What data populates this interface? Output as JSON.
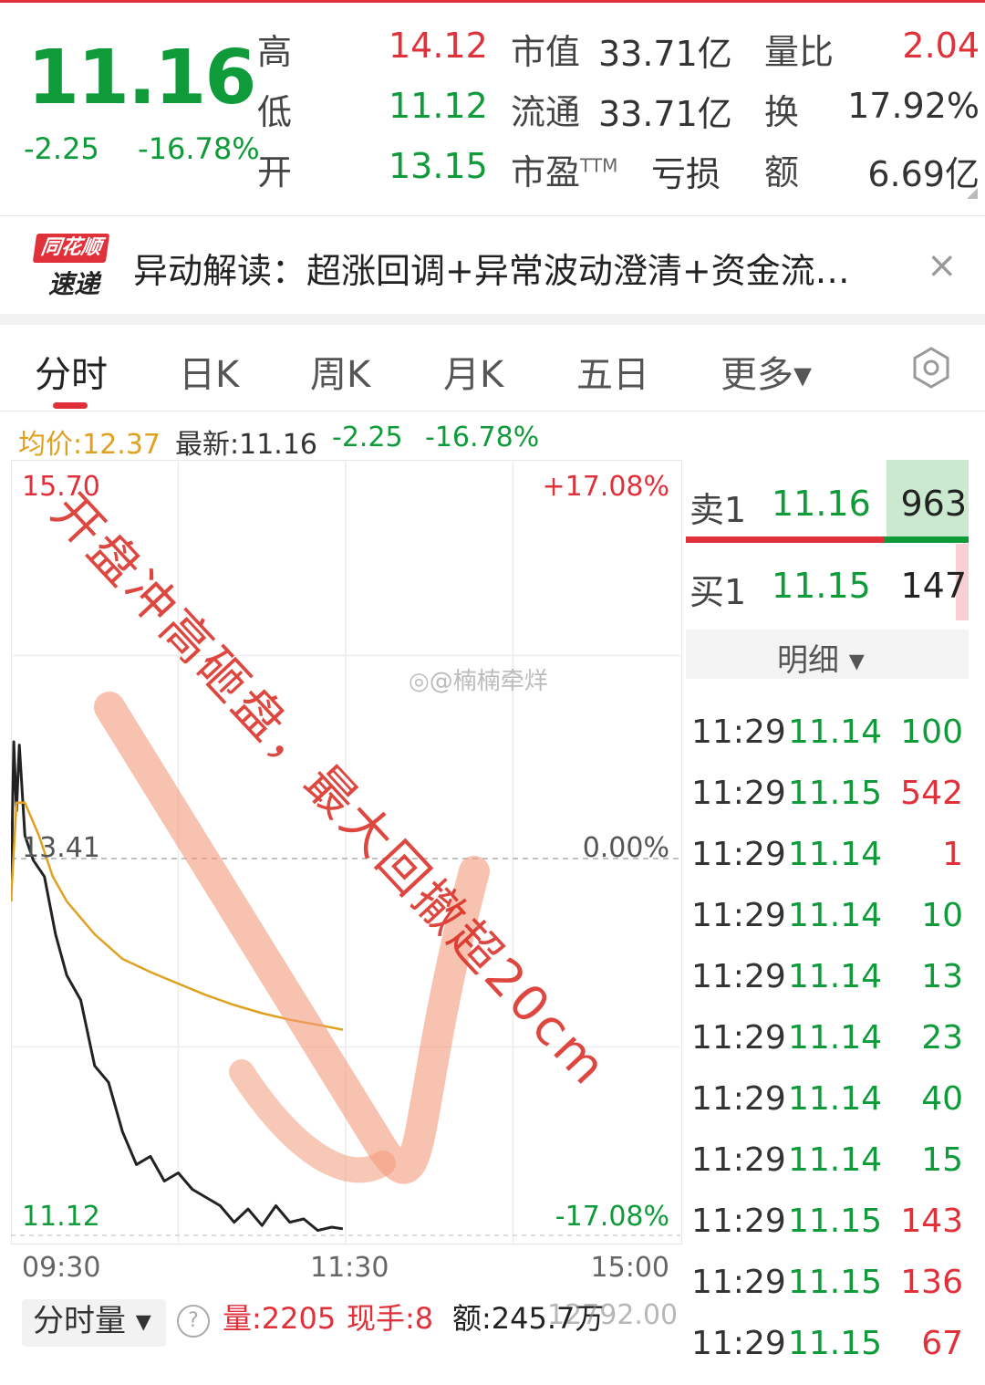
{
  "quote": {
    "price": "11.16",
    "change": "-2.25",
    "change_pct": "-16.78%",
    "high_label": "高",
    "high": "14.12",
    "low_label": "低",
    "low": "11.12",
    "open_label": "开",
    "open": "13.15",
    "mktcap_label": "市值",
    "mktcap": "33.71亿",
    "float_label": "流通",
    "float": "33.71亿",
    "pe_label": "市盈",
    "pe_sup": "TTM",
    "pe": "亏损",
    "volratio_label": "量比",
    "volratio": "2.04",
    "turnover_label": "换",
    "turnover": "17.92%",
    "amount_label": "额",
    "amount": "6.69亿"
  },
  "news": {
    "logo_top": "同花顺",
    "logo_bottom": "速递",
    "text": "异动解读：超涨回调+异常波动澄清+资金流…",
    "close_icon": "×"
  },
  "tabs": [
    "分时",
    "日K",
    "周K",
    "月K",
    "五日",
    "更多▾"
  ],
  "active_tab": "分时",
  "info_bar": {
    "avg": "均价:12.37",
    "latest": "最新:11.16",
    "change": "-2.25",
    "change_pct": "-16.78%"
  },
  "chart_labels": {
    "top_left": "15.70",
    "top_right": "+17.08%",
    "mid_left": "13.41",
    "mid_right": "0.00%",
    "bottom_left": "11.12",
    "bottom_right": "-17.08%",
    "x_start": "09:30",
    "x_mid": "11:30",
    "x_end": "15:00"
  },
  "order_book": {
    "sell_label": "卖1",
    "sell_price": "11.16",
    "sell_vol": "963",
    "buy_label": "买1",
    "buy_price": "11.15",
    "buy_vol": "147",
    "detail_label": "明细 ▾"
  },
  "ticks": [
    {
      "time": "11:29",
      "price": "11.14",
      "vol": "100",
      "dir": "green"
    },
    {
      "time": "11:29",
      "price": "11.15",
      "vol": "542",
      "dir": "red"
    },
    {
      "time": "11:29",
      "price": "11.14",
      "vol": "1",
      "dir": "red"
    },
    {
      "time": "11:29",
      "price": "11.14",
      "vol": "10",
      "dir": "green"
    },
    {
      "time": "11:29",
      "price": "11.14",
      "vol": "13",
      "dir": "green"
    },
    {
      "time": "11:29",
      "price": "11.14",
      "vol": "23",
      "dir": "green"
    },
    {
      "time": "11:29",
      "price": "11.14",
      "vol": "40",
      "dir": "green"
    },
    {
      "time": "11:29",
      "price": "11.14",
      "vol": "15",
      "dir": "green"
    },
    {
      "time": "11:29",
      "price": "11.15",
      "vol": "143",
      "dir": "red"
    },
    {
      "time": "11:29",
      "price": "11.15",
      "vol": "136",
      "dir": "red"
    },
    {
      "time": "11:29",
      "price": "11.15",
      "vol": "67",
      "dir": "red"
    }
  ],
  "bottom_bar": {
    "volume_selector": "分时量 ▾",
    "help_icon": "?",
    "vol": "量:2205",
    "current_hand": "现手:8",
    "amount": "额:245.7万",
    "right_value": "12792.00"
  },
  "annotation": {
    "text": "开盘冲高砸盘，最大回撤超20cm",
    "watermark": "@楠楠牵烊"
  },
  "chart_data": {
    "type": "line",
    "x_range": [
      "09:30",
      "15:00"
    ],
    "ylim": [
      11.12,
      15.7
    ],
    "reference": 13.41,
    "series": [
      {
        "color": "#222222",
        "x": [
          "09:30",
          "09:31",
          "09:32",
          "09:33",
          "09:35",
          "09:38",
          "09:42",
          "09:46",
          "09:50",
          "09:55",
          "10:00",
          "10:05",
          "10:10",
          "10:15",
          "10:20",
          "10:25",
          "10:30",
          "10:35",
          "10:40",
          "10:45",
          "10:50",
          "10:55",
          "11:00",
          "11:05",
          "11:10",
          "11:15",
          "11:20",
          "11:25",
          "11:29"
        ],
        "values": [
          13.15,
          14.12,
          13.7,
          14.1,
          13.55,
          13.4,
          13.3,
          12.95,
          12.7,
          12.55,
          12.15,
          12.05,
          11.75,
          11.55,
          11.6,
          11.45,
          11.5,
          11.4,
          11.35,
          11.3,
          11.2,
          11.28,
          11.18,
          11.3,
          11.2,
          11.22,
          11.15,
          11.17,
          11.16
        ]
      },
      {
        "color": "#e0a020",
        "x": [
          "09:30",
          "09:32",
          "09:35",
          "09:40",
          "09:45",
          "09:50",
          "10:00",
          "10:10",
          "10:20",
          "10:30",
          "10:40",
          "10:50",
          "11:00",
          "11:10",
          "11:20",
          "11:29"
        ],
        "values": [
          13.15,
          13.75,
          13.75,
          13.55,
          13.3,
          13.15,
          12.95,
          12.8,
          12.72,
          12.65,
          12.58,
          12.52,
          12.47,
          12.43,
          12.4,
          12.37
        ]
      }
    ]
  }
}
